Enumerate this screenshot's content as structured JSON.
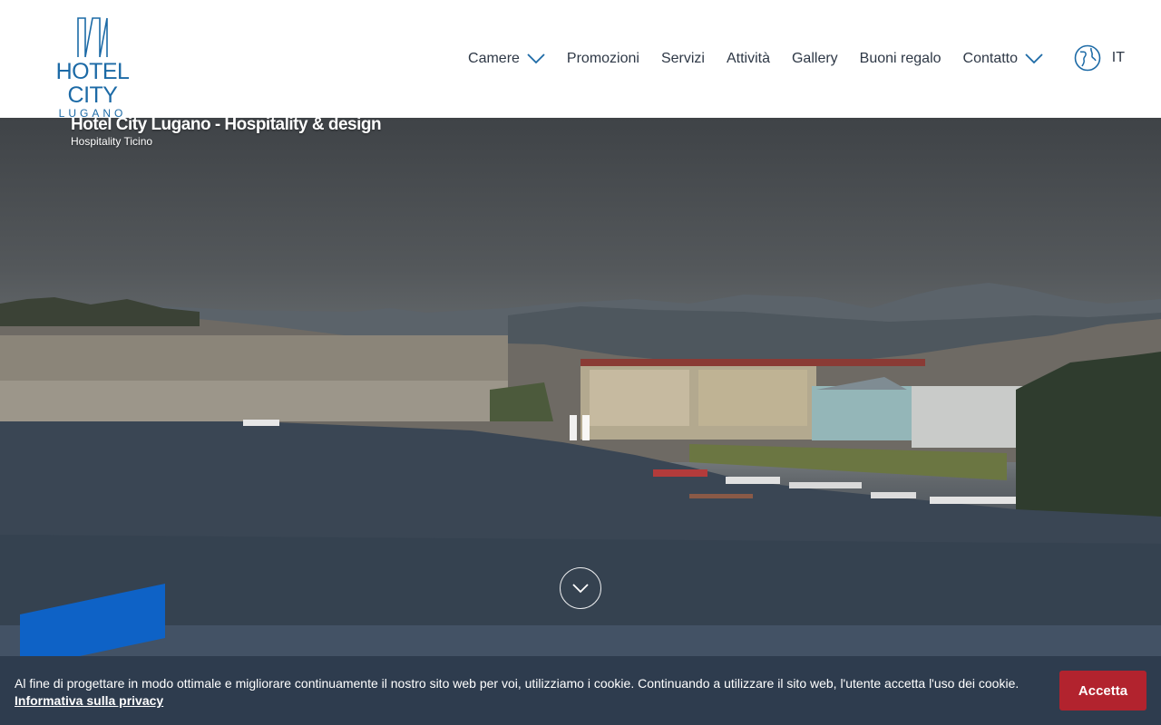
{
  "brand": {
    "name": "HOTEL CITY",
    "location": "LUGANO"
  },
  "nav": {
    "items": [
      {
        "label": "Camere",
        "has_dropdown": true
      },
      {
        "label": "Promozioni",
        "has_dropdown": false
      },
      {
        "label": "Servizi",
        "has_dropdown": false
      },
      {
        "label": "Attività",
        "has_dropdown": false
      },
      {
        "label": "Gallery",
        "has_dropdown": false
      },
      {
        "label": "Buoni regalo",
        "has_dropdown": false
      },
      {
        "label": "Contatto",
        "has_dropdown": true
      }
    ],
    "language": "IT",
    "language_icon": "globe-icon"
  },
  "hero": {
    "title": "Hotel City Lugano - Hospitality & design",
    "subtitle": "Hospitality Ticino",
    "pause_icon": "pause-icon",
    "scroll_icon": "chevron-down-icon"
  },
  "cookie": {
    "text": "Al fine di progettare in modo ottimale e migliorare continuamente il nostro sito web per voi, utilizziamo i cookie. Continuando a utilizzare il sito web, l'utente accetta l'uso dei cookie.",
    "privacy_link": "Informativa sulla privacy",
    "accept_label": "Accetta"
  },
  "colors": {
    "brand_blue": "#1c6aa6",
    "cookie_bg": "#2e3c4e",
    "accept_red": "#b2232e",
    "accent_blue": "#0e62c6"
  }
}
